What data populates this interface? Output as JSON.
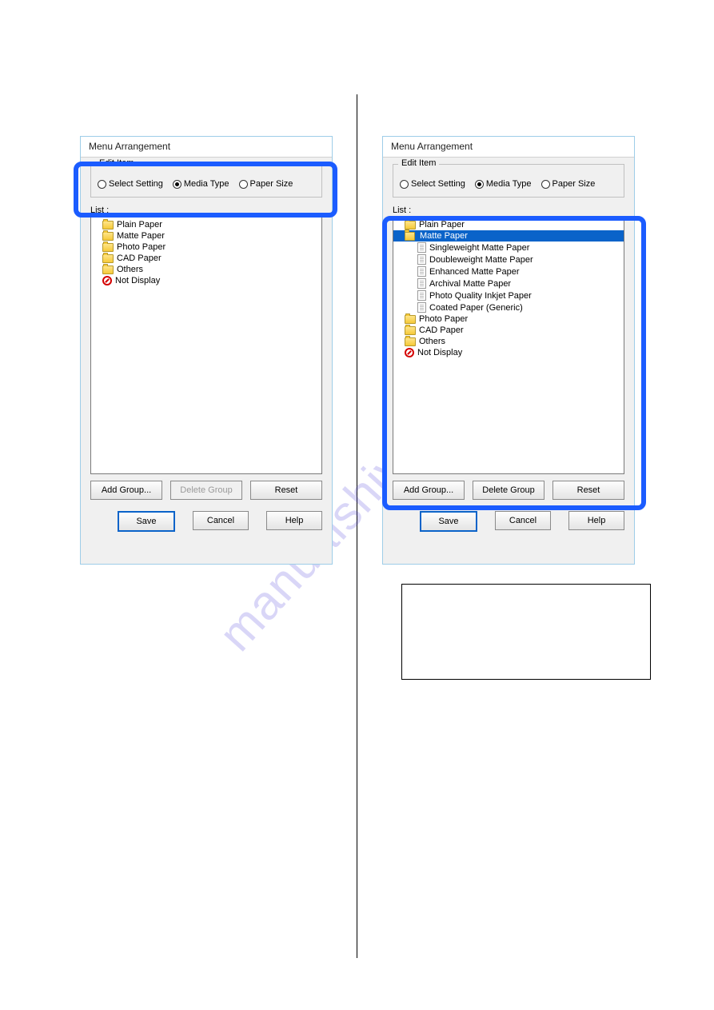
{
  "watermark": "manualshive.com",
  "dialogLeft": {
    "title": "Menu Arrangement",
    "editItemLabel": "Edit Item",
    "radios": [
      {
        "label": "Select Setting",
        "selected": false
      },
      {
        "label": "Media Type",
        "selected": true
      },
      {
        "label": "Paper Size",
        "selected": false
      }
    ],
    "listLabel": "List :",
    "tree": [
      {
        "icon": "folder",
        "label": "Plain Paper"
      },
      {
        "icon": "folder",
        "label": "Matte Paper"
      },
      {
        "icon": "folder",
        "label": "Photo Paper"
      },
      {
        "icon": "folder",
        "label": "CAD Paper"
      },
      {
        "icon": "folder",
        "label": "Others"
      },
      {
        "icon": "no",
        "label": "Not Display"
      }
    ],
    "buttons": {
      "addGroup": "Add Group...",
      "deleteGroup": "Delete Group",
      "reset": "Reset",
      "deleteGroupDisabled": true
    },
    "footer": {
      "save": "Save",
      "cancel": "Cancel",
      "help": "Help"
    }
  },
  "dialogRight": {
    "title": "Menu Arrangement",
    "editItemLabel": "Edit Item",
    "radios": [
      {
        "label": "Select Setting",
        "selected": false
      },
      {
        "label": "Media Type",
        "selected": true
      },
      {
        "label": "Paper Size",
        "selected": false
      }
    ],
    "listLabel": "List :",
    "tree": [
      {
        "icon": "folder",
        "label": "Plain Paper"
      },
      {
        "icon": "folder-open",
        "label": "Matte Paper",
        "selected": true
      },
      {
        "icon": "doc",
        "label": "Singleweight Matte Paper",
        "child": true
      },
      {
        "icon": "doc",
        "label": "Doubleweight Matte Paper",
        "child": true
      },
      {
        "icon": "doc",
        "label": "Enhanced Matte Paper",
        "child": true
      },
      {
        "icon": "doc",
        "label": "Archival Matte Paper",
        "child": true
      },
      {
        "icon": "doc",
        "label": "Photo Quality Inkjet Paper",
        "child": true
      },
      {
        "icon": "doc",
        "label": "Coated Paper (Generic)",
        "child": true
      },
      {
        "icon": "folder",
        "label": "Photo Paper"
      },
      {
        "icon": "folder",
        "label": "CAD Paper"
      },
      {
        "icon": "folder",
        "label": "Others"
      },
      {
        "icon": "no",
        "label": "Not Display"
      }
    ],
    "buttons": {
      "addGroup": "Add Group...",
      "deleteGroup": "Delete Group",
      "reset": "Reset",
      "deleteGroupDisabled": false
    },
    "footer": {
      "save": "Save",
      "cancel": "Cancel",
      "help": "Help"
    }
  }
}
